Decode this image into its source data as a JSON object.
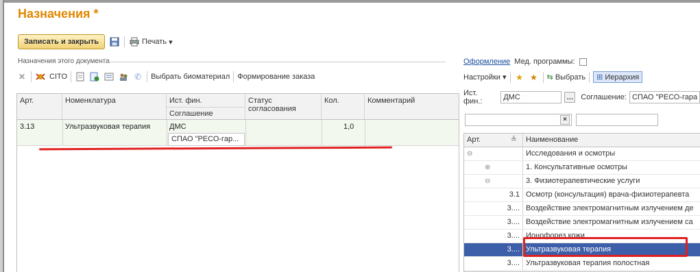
{
  "title": "Назначения *",
  "toolbar": {
    "write_close": "Записать и закрыть",
    "print": "Печать"
  },
  "section_label": "Назначения этого документа",
  "tools": {
    "cito": "CITO",
    "biomaterial": "Выбрать биоматериал",
    "order": "Формирование заказа"
  },
  "table": {
    "headers": {
      "art": "Арт.",
      "nomenclature": "Номенклатура",
      "fin": "Ист. фин.",
      "agreement": "Соглашение",
      "status": "Статус согласования",
      "qty": "Кол.",
      "comment": "Комментарий"
    },
    "rows": [
      {
        "art": "3.13",
        "name": "Ультразвуковая терапия",
        "fin": "ДМС",
        "agreement": "СПАО \"РЕСО-гар...",
        "qty": "1,0"
      }
    ]
  },
  "right": {
    "design_link": "Оформление",
    "med_programs": "Мед. программы:",
    "settings": "Настройки",
    "select": "Выбрать",
    "hierarchy": "Иерархия",
    "fin_label": "Ист. фин.:",
    "fin_value": "ДМС",
    "agreement_label": "Соглашение:",
    "agreement_value": "СПАО \"РЕСО-гара",
    "tree_headers": {
      "art": "Арт.",
      "name": "Наименование"
    },
    "tree": [
      {
        "art": "",
        "name": "Исследования и осмотры"
      },
      {
        "art": "",
        "name": "1. Консультативные осмотры"
      },
      {
        "art": "",
        "name": "3. Физиотерапевтические услуги"
      },
      {
        "art": "3.1",
        "name": "Осмотр (консультация) врача-физиотерапевта"
      },
      {
        "art": "3....",
        "name": "Воздействие электромагнитным излучением де"
      },
      {
        "art": "3....",
        "name": "Воздействие электромагнитным излучением са"
      },
      {
        "art": "3....",
        "name": "Ионофорез кожи"
      },
      {
        "art": "3....",
        "name": "Ультразвуковая терапия"
      },
      {
        "art": "3....",
        "name": "Ультразвуковая терапия полостная"
      }
    ]
  }
}
